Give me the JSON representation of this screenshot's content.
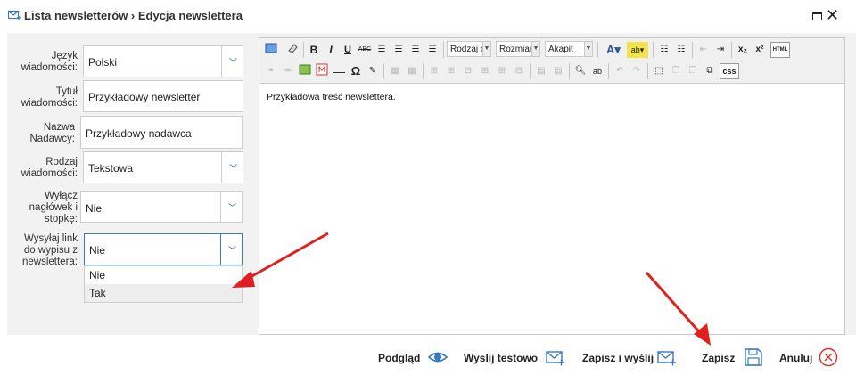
{
  "window": {
    "title": "Lista newsletterów › Edycja newslettera",
    "icon": "newsletter-envelope-icon",
    "controls": [
      "maximize-icon",
      "close-icon"
    ]
  },
  "form": {
    "language": {
      "label": "Język wiadomości:",
      "value": "Polski"
    },
    "title": {
      "label": "Tytuł wiadomości:",
      "value": "Przykładowy newsletter"
    },
    "sender": {
      "label": "Nazwa Nadawcy:",
      "value": "Przykładowy nadawca"
    },
    "message_type": {
      "label": "Rodzaj wiadomości:",
      "value": "Tekstowa"
    },
    "disable_header": {
      "label": "Wyłącz nagłówek i stopkę:",
      "value": "Nie"
    },
    "unsubscribe_link": {
      "label": "Wysyłaj link do wypisu z newslettera:",
      "value": "Nie",
      "options": [
        "Nie",
        "Tak"
      ],
      "highlighted_option": "Tak"
    }
  },
  "editor": {
    "toolbar": {
      "combo_format": "Rodzaj c",
      "combo_size": "Rozmiar",
      "combo_paragraph": "Akapit",
      "bold": "B",
      "italic": "I",
      "underline": "U",
      "strike": "ABC",
      "subscript": "x₂",
      "superscript": "x²",
      "html": "HTML",
      "css": "css",
      "omega": "Ω"
    },
    "content": "Przykładowa treść newslettera."
  },
  "actions": {
    "preview": "Podgląd",
    "send_test": "Wyslij testowo",
    "save_send": "Zapisz i wyślij",
    "save": "Zapisz",
    "cancel": "Anuluj"
  },
  "colors": {
    "accent_blue": "#3b78c4",
    "annotation_red": "#e02020",
    "cancel_red": "#d93025"
  }
}
